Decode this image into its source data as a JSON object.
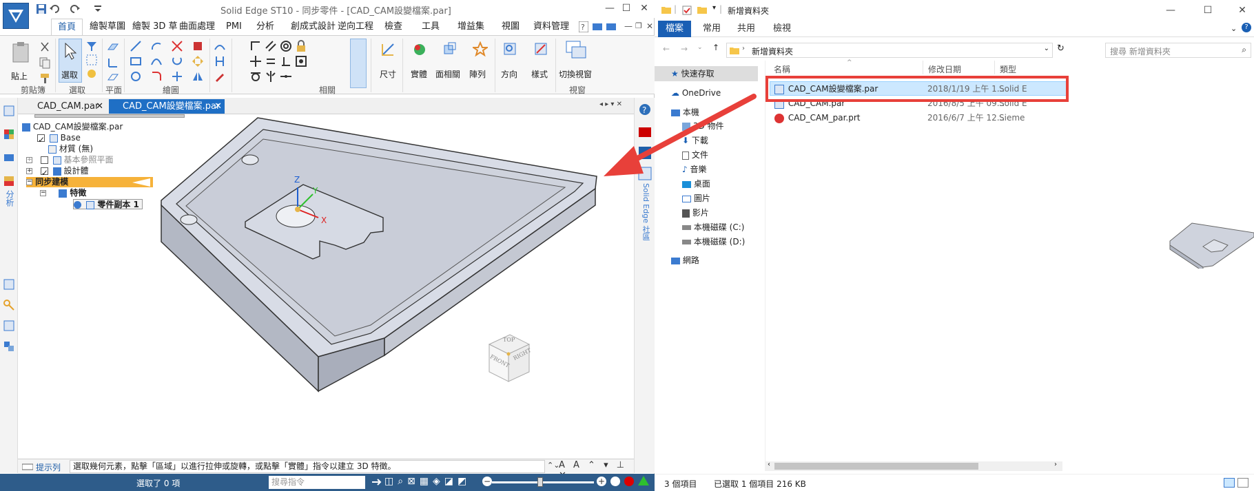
{
  "solid_edge": {
    "title": "Solid Edge ST10 - 同步零件 - [CAD_CAM設變檔案.par]",
    "tabs": [
      "首頁",
      "繪製草圖",
      "繪製 3D 草",
      "曲面處理",
      "PMI",
      "分析",
      "創成式設計",
      "逆向工程",
      "檢查",
      "工具",
      "增益集",
      "視圖",
      "資料管理"
    ],
    "ribbon": {
      "paste_label": "貼上",
      "select_label": "選取",
      "dimension_label": "尺寸",
      "solid_label": "實體",
      "face_rel_label": "面相關",
      "pattern_label": "陣列",
      "orient_label": "方向",
      "style_label": "樣式",
      "switch_window_label": "切換視窗",
      "groups": [
        "剪貼簿",
        "選取",
        "平面",
        "繪圖",
        "相關",
        "視窗"
      ]
    },
    "doc_tabs": [
      "CAD_CAM.par",
      "CAD_CAM設變檔案.par"
    ],
    "tree": {
      "root": "CAD_CAM設變檔案.par",
      "base": "Base",
      "material": "材質 (無)",
      "ref_planes": "基本參照平面",
      "design_body": "設計體",
      "sync": "同步建模",
      "features": "特徵",
      "part_copy": "零件副本 1"
    },
    "left_side_label": "分析",
    "right_side_label": "Solid Edge 社區",
    "viewcube": [
      "TOP",
      "FRONT",
      "RIGHT"
    ],
    "axes": [
      "Z",
      "Y",
      "X"
    ],
    "prompt_label": "提示列",
    "prompt_text": "選取幾何元素，點擊「區域」以進行拉伸或旋轉，或點擊「實體」指令以建立 3D 特徵。",
    "status_selected": "選取了 0 項",
    "status_search_placeholder": "搜尋指令"
  },
  "explorer": {
    "title": "新增資料夾",
    "ribbon_tabs": [
      "檔案",
      "常用",
      "共用",
      "檢視"
    ],
    "path": "新增資料夾",
    "search_placeholder": "搜尋 新增資料夾",
    "columns": [
      "名稱",
      "修改日期",
      "類型"
    ],
    "files": [
      {
        "name": "CAD_CAM設變檔案.par",
        "date": "2018/1/19 上午 1...",
        "type": "Solid E"
      },
      {
        "name": "CAD_CAM.par",
        "date": "2016/8/5 上午 09...",
        "type": "Solid E"
      },
      {
        "name": "CAD_CAM_par.prt",
        "date": "2016/6/7 上午 12...",
        "type": "Sieme"
      }
    ],
    "nav": [
      "快速存取",
      "OneDrive",
      "本機",
      "3D 物件",
      "下載",
      "文件",
      "音樂",
      "桌面",
      "圖片",
      "影片",
      "本機磁碟 (C:)",
      "本機磁碟 (D:)",
      "網路"
    ],
    "status": {
      "count": "3 個項目",
      "selected": "已選取 1 個項目  216 KB"
    }
  },
  "colors": {
    "accent": "#1a5fb4",
    "highlight": "#e8403a",
    "sync_bar": "#f6b23a"
  }
}
